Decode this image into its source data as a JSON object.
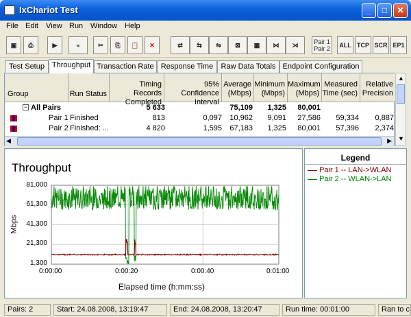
{
  "window": {
    "title": "IxChariot Test"
  },
  "menu": [
    "File",
    "Edit",
    "View",
    "Run",
    "Window",
    "Help"
  ],
  "toolbar": {
    "pair_label_1": "Pair 1",
    "pair_label_2": "Pair 2",
    "filters": [
      "ALL",
      "TCP",
      "SCR",
      "EP1"
    ]
  },
  "tabs": [
    "Test Setup",
    "Throughput",
    "Transaction Rate",
    "Response Time",
    "Raw Data Totals",
    "Endpoint Configuration"
  ],
  "active_tab": "Throughput",
  "table": {
    "headers": [
      "Group",
      "Run Status",
      "Timing Records Completed",
      "95% Confidence Interval",
      "Average (Mbps)",
      "Minimum (Mbps)",
      "Maximum (Mbps)",
      "Measured Time (sec)",
      "Relative Precision"
    ],
    "summary": {
      "group": "All Pairs",
      "records": "5 633",
      "average": "75,109",
      "minimum": "1,325",
      "maximum": "80,001"
    },
    "rows": [
      {
        "group": "Pair 1",
        "status": "Finished",
        "records": "813",
        "ci": "0,097",
        "average": "10,962",
        "minimum": "9,091",
        "maximum": "27,586",
        "time": "59,334",
        "precision": "0,887"
      },
      {
        "group": "Pair 2",
        "status": "Finished: ...",
        "records": "4 820",
        "ci": "1,595",
        "average": "67,183",
        "minimum": "1,325",
        "maximum": "80,001",
        "time": "57,396",
        "precision": "2,374"
      }
    ]
  },
  "chart": {
    "title": "Throughput",
    "ylabel": "Mbps",
    "xlabel": "Elapsed time (h:mm:ss)",
    "yticks": [
      "81,000",
      "61,300",
      "41,300",
      "21,300",
      "1,300"
    ],
    "xticks": [
      "0:00:00",
      "0:00:20",
      "0:00:40",
      "0:01:00"
    ]
  },
  "chart_data": {
    "type": "line",
    "title": "Throughput",
    "xlabel": "Elapsed time (h:mm:ss)",
    "ylabel": "Mbps",
    "ylim": [
      1.3,
      81.0
    ],
    "xlim": [
      0,
      60
    ],
    "grid": true,
    "series": [
      {
        "name": "Pair 1 -- LAN->WLAN",
        "color": "#800000",
        "values_summary": {
          "average": 10.962,
          "min": 9.091,
          "max": 27.586
        }
      },
      {
        "name": "Pair 2 -- WLAN->LAN",
        "color": "#008000",
        "values_summary": {
          "average": 67.183,
          "min": 1.325,
          "max": 80.001
        }
      }
    ]
  },
  "legend": {
    "title": "Legend",
    "items": [
      {
        "label": "Pair 1 -- LAN->WLAN",
        "color": "#800000"
      },
      {
        "label": "Pair 2 -- WLAN->LAN",
        "color": "#008000"
      }
    ]
  },
  "status": {
    "pairs": "Pairs: 2",
    "start": "Start: 24.08.2008, 13:19:47",
    "end": "End: 24.08.2008, 13:20:47",
    "runtime": "Run time: 00:01:00",
    "ran": "Ran to c"
  }
}
